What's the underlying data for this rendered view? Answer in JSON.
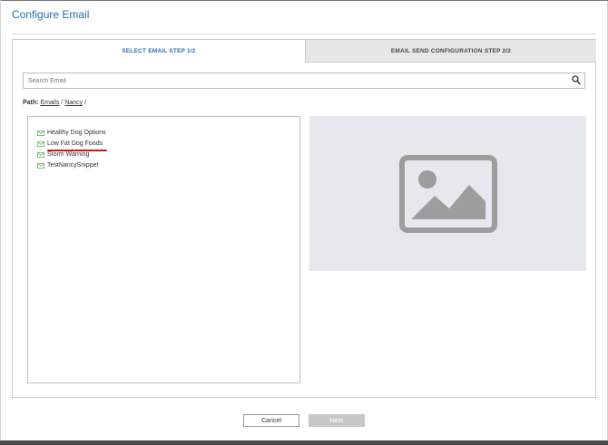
{
  "dialog": {
    "title": "Configure Email"
  },
  "tabs": [
    {
      "label": "SELECT EMAIL STEP 1/2",
      "active": true
    },
    {
      "label": "EMAIL SEND CONFIGURATION STEP 2/2",
      "active": false
    }
  ],
  "search": {
    "placeholder": "Search Email",
    "value": "",
    "icon": "search-icon"
  },
  "path": {
    "label": "Path:",
    "crumbs": [
      "Emails",
      "Nancy"
    ],
    "separator": "/"
  },
  "emails": [
    {
      "name": "Healthy Dog Options",
      "icon": "envelope-icon"
    },
    {
      "name": "Low Fat Dog Foods",
      "icon": "envelope-icon",
      "highlighted": true
    },
    {
      "name": "Storm Warning",
      "icon": "envelope-icon"
    },
    {
      "name": "TestNancySnippet",
      "icon": "envelope-icon"
    }
  ],
  "preview": {
    "icon": "image-placeholder-icon"
  },
  "buttons": {
    "cancel_label": "Cancel",
    "next_label": "Next",
    "next_enabled": false
  },
  "colors": {
    "accent": "#1f6fb2",
    "annotation_underline": "#d6141e",
    "mail_icon": "#6cb36c",
    "preview_bg": "#e5e8ed",
    "disabled_button": "#c6c7c9"
  }
}
